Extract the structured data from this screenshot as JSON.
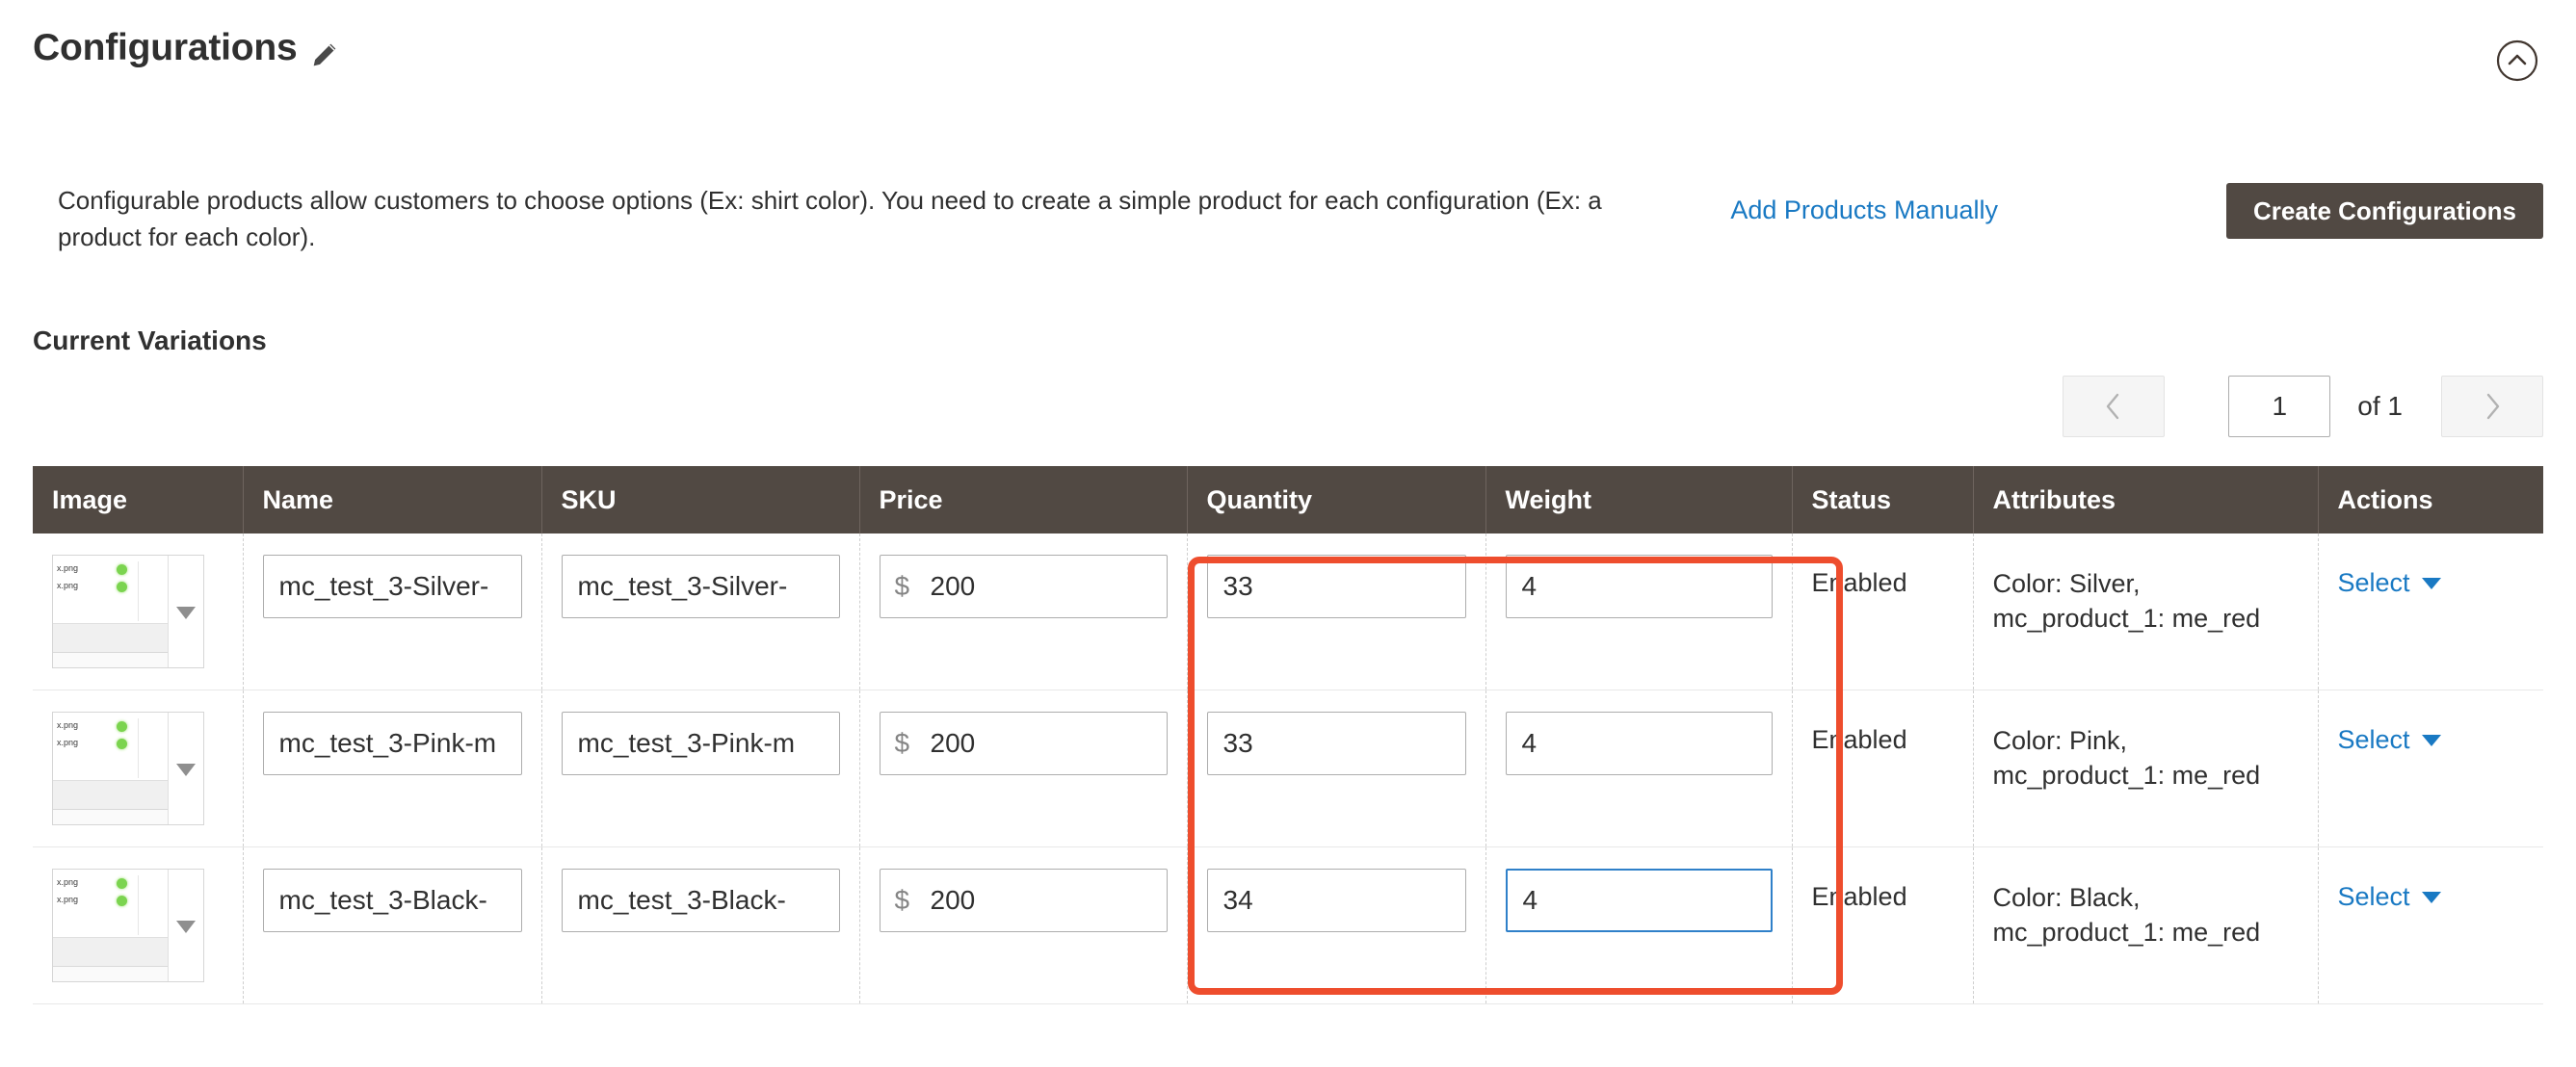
{
  "header": {
    "title": "Configurations",
    "edit_icon": "pencil-icon",
    "collapse_icon": "chevron-up-circle-icon"
  },
  "description": "Configurable products allow customers to choose options (Ex: shirt color). You need to create a simple product for each configuration (Ex: a product for each color).",
  "actions": {
    "add_products_manually": "Add Products Manually",
    "create_configurations": "Create Configurations"
  },
  "variations": {
    "title": "Current Variations",
    "pagination": {
      "prev_icon": "chevron-left-icon",
      "next_icon": "chevron-right-icon",
      "current_page": "1",
      "of_label": "of 1"
    },
    "columns": [
      "Image",
      "Name",
      "SKU",
      "Price",
      "Quantity",
      "Weight",
      "Status",
      "Attributes",
      "Actions"
    ],
    "price_symbol": "$",
    "thumbnail": {
      "line1": "x.png",
      "line2": "x.png"
    },
    "rows": [
      {
        "name": "mc_test_3-Silver-",
        "sku": "mc_test_3-Silver-",
        "price": "200",
        "quantity": "33",
        "weight": "4",
        "status": "Enabled",
        "attributes_line1": "Color: Silver,",
        "attributes_line2": "mc_product_1: me_red",
        "action_label": "Select",
        "highlighted": false,
        "weight_focused": false
      },
      {
        "name": "mc_test_3-Pink-m",
        "sku": "mc_test_3-Pink-m",
        "price": "200",
        "quantity": "33",
        "weight": "4",
        "status": "Enabled",
        "attributes_line1": "Color: Pink,",
        "attributes_line2": "mc_product_1: me_red",
        "action_label": "Select",
        "highlighted": true,
        "weight_focused": false
      },
      {
        "name": "mc_test_3-Black-",
        "sku": "mc_test_3-Black-",
        "price": "200",
        "quantity": "34",
        "weight": "4",
        "status": "Enabled",
        "attributes_line1": "Color: Black,",
        "attributes_line2": "mc_product_1: me_red",
        "action_label": "Select",
        "highlighted": false,
        "weight_focused": true
      }
    ]
  },
  "colors": {
    "header_bar": "#514943",
    "link_blue": "#1979c3",
    "row_highlight": "#e5f3fb",
    "annotation_red": "#ee4d2d",
    "focus_blue": "#2f80c9"
  }
}
